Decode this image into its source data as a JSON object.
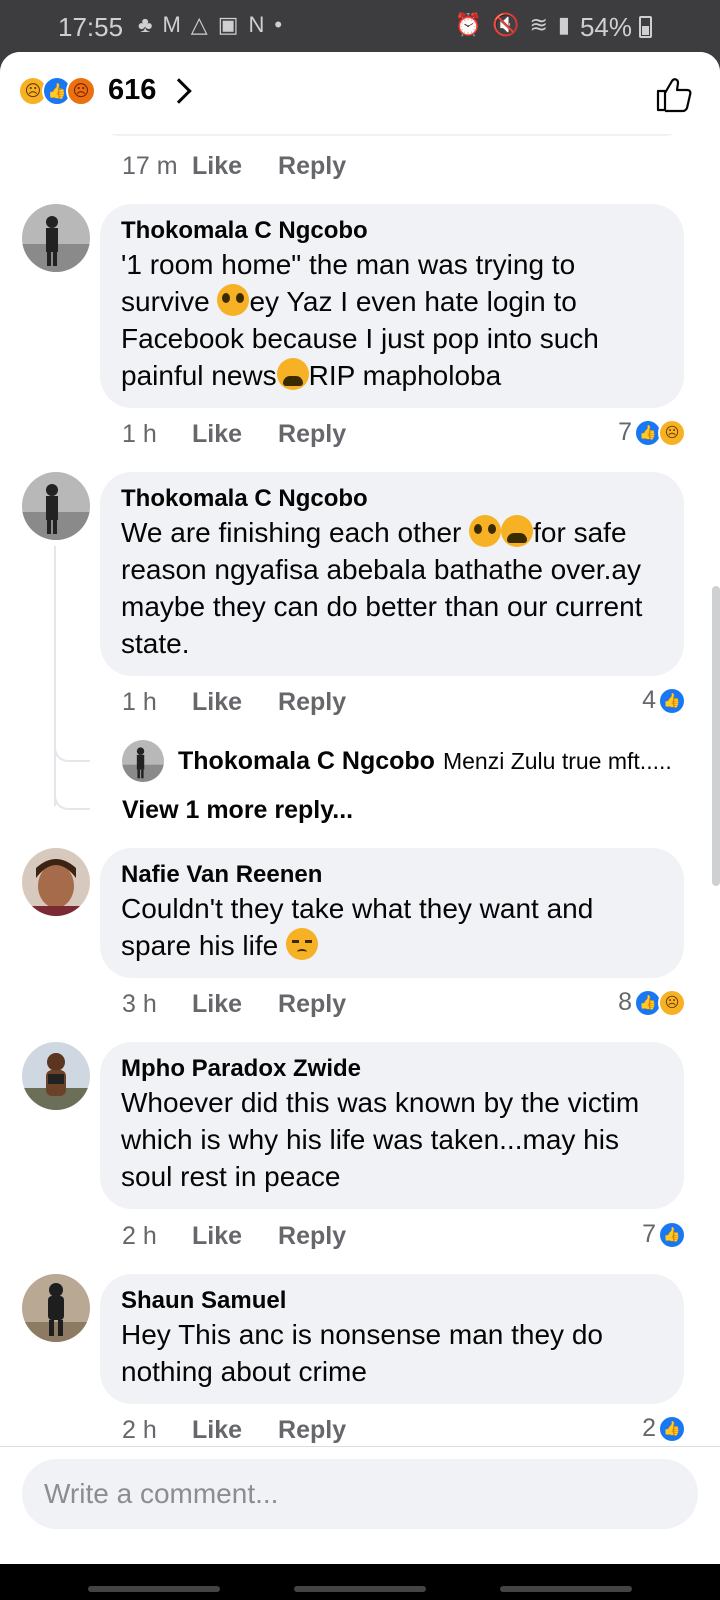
{
  "status_bar": {
    "time": "17:55",
    "left_icons": [
      "app-icon",
      "mail-icon",
      "alert-icon",
      "inbox-icon",
      "n-icon",
      "dot-icon"
    ],
    "right_icons": [
      "alarm-icon",
      "mute-icon",
      "wifi-icon",
      "signal-icon"
    ],
    "battery": "54%"
  },
  "header": {
    "reaction_icons": [
      "sad-reaction",
      "like-reaction",
      "angry-reaction"
    ],
    "reaction_count": "616",
    "like_icon": "thumbs-up-icon"
  },
  "labels": {
    "like": "Like",
    "reply": "Reply"
  },
  "top_comment": {
    "time": "17 m"
  },
  "comments": [
    {
      "name": "Thokomala C Ngcobo",
      "text_parts": [
        "'1 room home\" the man was trying to survive ",
        "ey Yaz I even hate login to Facebook because I just pop into such painful news",
        "RIP mapholoba"
      ],
      "time": "1 h",
      "reaction_count": "7",
      "reactions": [
        "like",
        "sad"
      ]
    },
    {
      "name": "Thokomala C Ngcobo",
      "text_parts": [
        "We are finishing each other ",
        "for safe reason ngyafisa abebala bathathe over.ay maybe they can do better than our current state."
      ],
      "time": "1 h",
      "reaction_count": "4",
      "reactions": [
        "like"
      ],
      "reply_preview": {
        "name": "Thokomala C Ngcobo",
        "text": "Menzi Zulu true mft....."
      },
      "view_more": "View 1 more reply..."
    },
    {
      "name": "Nafie Van Reenen",
      "text_parts": [
        "Couldn't they take what they want and spare his life "
      ],
      "time": "3 h",
      "reaction_count": "8",
      "reactions": [
        "like",
        "sad"
      ]
    },
    {
      "name": "Mpho Paradox Zwide",
      "text_parts": [
        "Whoever did this was known by the victim which is why his life was taken...may his soul rest in peace"
      ],
      "time": "2 h",
      "reaction_count": "7",
      "reactions": [
        "like"
      ]
    },
    {
      "name": "Shaun Samuel",
      "text_parts": [
        "Hey This anc is nonsense man they do nothing about crime"
      ],
      "time": "2 h",
      "reaction_count": "2",
      "reactions": [
        "like"
      ]
    }
  ],
  "composer": {
    "placeholder": "Write a comment..."
  },
  "colors": {
    "accent": "#1877f2",
    "bubble": "#f0f2f5",
    "muted": "#65676b"
  }
}
